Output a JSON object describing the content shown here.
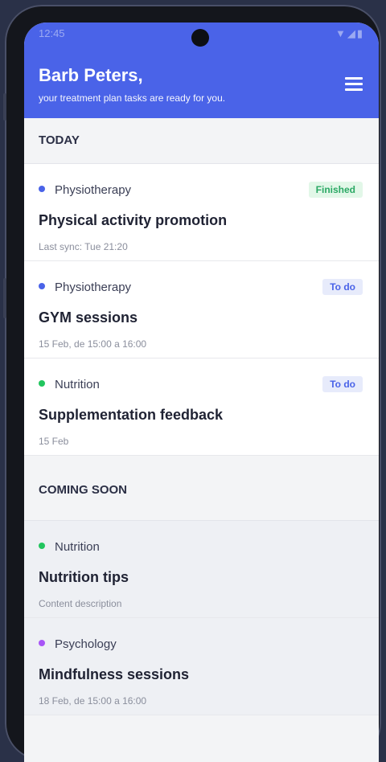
{
  "status_bar": {
    "time": "12:45",
    "icons": "▼◢▮"
  },
  "header": {
    "greeting": "Barb Peters,",
    "subtitle": "your treatment plan tasks are ready for you."
  },
  "sections": {
    "today": "TODAY",
    "coming_soon": "COMING SOON"
  },
  "today_cards": [
    {
      "category": "Physiotherapy",
      "title": "Physical activity promotion",
      "meta": "Last sync: Tue 21:20",
      "badge": "Finished"
    },
    {
      "category": "Physiotherapy",
      "title": "GYM sessions",
      "meta": "15 Feb, de 15:00 a 16:00",
      "badge": "To do"
    },
    {
      "category": "Nutrition",
      "title": "Supplementation feedback",
      "meta": "15 Feb",
      "badge": "To do"
    }
  ],
  "soon_cards": [
    {
      "category": "Nutrition",
      "title": "Nutrition tips",
      "meta": "Content description"
    },
    {
      "category": "Psychology",
      "title": "Mindfulness sessions",
      "meta": "18 Feb, de 15:00 a 16:00"
    }
  ],
  "colors": {
    "header": "#4a63e8",
    "physiotherapy": "#4a63e8",
    "nutrition": "#22c55e",
    "psychology": "#a855f7",
    "finished": "#2aa864"
  }
}
